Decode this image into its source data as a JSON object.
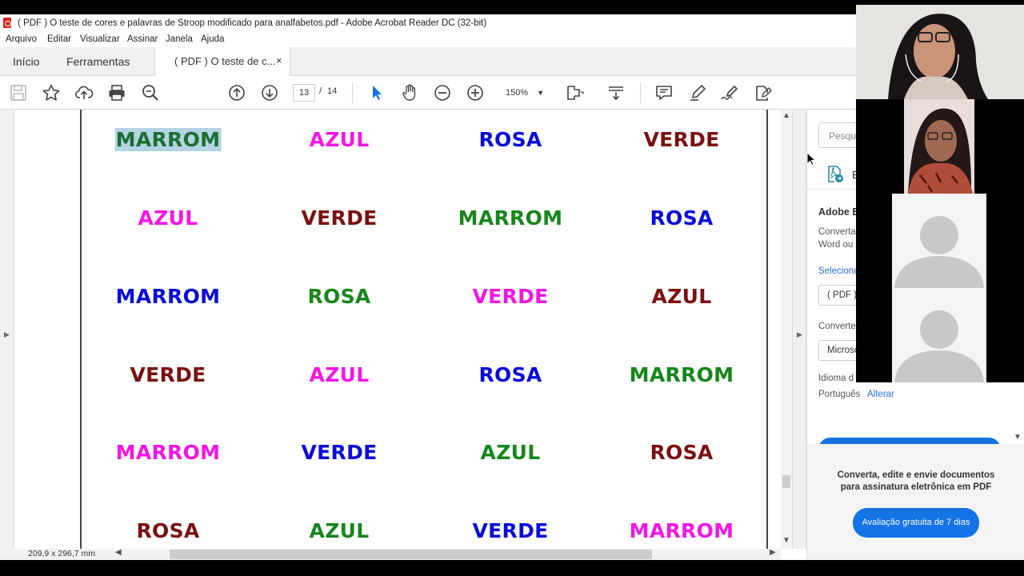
{
  "window": {
    "title": "( PDF ) O teste de cores e palavras de Stroop modificado para analfabetos.pdf - Adobe Acrobat Reader DC (32-bit)"
  },
  "menu": [
    "Arquivo",
    "Editar",
    "Visualizar",
    "Assinar",
    "Janela",
    "Ajuda"
  ],
  "tabs": {
    "home": "Início",
    "tools": "Ferramentas",
    "document": "( PDF ) O teste de c...",
    "close": "×"
  },
  "toolbar": {
    "icons": [
      "save-icon",
      "star-icon",
      "upload-icon",
      "print-icon",
      "zoom-search-icon",
      "page-up-icon",
      "page-down-icon",
      "select-cursor-icon",
      "hand-icon",
      "zoom-out-icon",
      "zoom-in-icon",
      "fit-page-icon",
      "scroll-mode-icon",
      "comment-icon",
      "highlight-icon",
      "sign-icon",
      "fill-sign-icon"
    ],
    "page_current": "13",
    "page_sep": "/",
    "page_total": "14",
    "zoom": "150%"
  },
  "document": {
    "colors": {
      "brown": "#7b0f0f",
      "blue": "#0a0adb",
      "pink": "#f316e6",
      "green": "#16861a",
      "green_selected": "#1d6e33"
    },
    "rows": [
      [
        {
          "text": "MARROM",
          "color": "#1d6e33",
          "selected": true
        },
        {
          "text": "AZUL",
          "color": "#f316e6"
        },
        {
          "text": "ROSA",
          "color": "#0a0adb"
        },
        {
          "text": "VERDE",
          "color": "#7b0f0f"
        }
      ],
      [
        {
          "text": "AZUL",
          "color": "#f316e6"
        },
        {
          "text": "VERDE",
          "color": "#7b0f0f"
        },
        {
          "text": "MARROM",
          "color": "#16861a"
        },
        {
          "text": "ROSA",
          "color": "#0a0adb"
        }
      ],
      [
        {
          "text": "MARROM",
          "color": "#0a0adb"
        },
        {
          "text": "ROSA",
          "color": "#16861a"
        },
        {
          "text": "VERDE",
          "color": "#f316e6"
        },
        {
          "text": "AZUL",
          "color": "#7b0f0f"
        }
      ],
      [
        {
          "text": "VERDE",
          "color": "#7b0f0f"
        },
        {
          "text": "AZUL",
          "color": "#f316e6"
        },
        {
          "text": "ROSA",
          "color": "#0a0adb"
        },
        {
          "text": "MARROM",
          "color": "#16861a"
        }
      ],
      [
        {
          "text": "MARROM",
          "color": "#f316e6"
        },
        {
          "text": "VERDE",
          "color": "#0a0adb"
        },
        {
          "text": "AZUL",
          "color": "#16861a"
        },
        {
          "text": "ROSA",
          "color": "#7b0f0f"
        }
      ],
      [
        {
          "text": "ROSA",
          "color": "#7b0f0f"
        },
        {
          "text": "AZUL",
          "color": "#16861a"
        },
        {
          "text": "VERDE",
          "color": "#0a0adb"
        },
        {
          "text": "MARROM",
          "color": "#f316e6"
        }
      ]
    ]
  },
  "status": {
    "dimensions": "209,9 x 296,7 mm"
  },
  "right_pane": {
    "search_placeholder": "Pesqu",
    "export_label": "E",
    "title": "Adobe E",
    "desc_line1": "Converta",
    "desc_line2": "Word ou",
    "select_link": "Seleciona",
    "file_value": "( PDF )",
    "convert_label": "Converte",
    "format_value": "Microso",
    "language_label": "Idioma d",
    "language_value": "Português",
    "change_link": "Alterar",
    "promo_line1": "Converta, edite e envie documentos",
    "promo_line2": "para assinatura eletrônica em PDF",
    "trial_button": "Avaliação gratuita de 7 dias"
  },
  "video_call": {
    "participants": [
      "participant-1",
      "participant-2",
      "participant-3",
      "participant-4"
    ]
  }
}
